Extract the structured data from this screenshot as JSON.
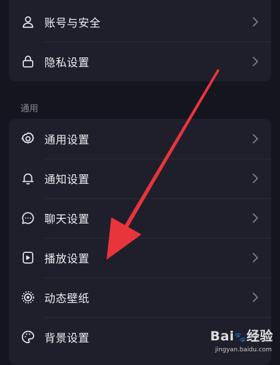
{
  "account_section": {
    "items": [
      {
        "label": "账号与安全",
        "icon": "user-icon"
      },
      {
        "label": "隐私设置",
        "icon": "lock-icon"
      }
    ]
  },
  "general_section": {
    "title": "通用",
    "items": [
      {
        "label": "通用设置",
        "icon": "gear-icon"
      },
      {
        "label": "通知设置",
        "icon": "bell-icon"
      },
      {
        "label": "聊天设置",
        "icon": "chat-bubble-icon"
      },
      {
        "label": "播放设置",
        "icon": "play-device-icon"
      },
      {
        "label": "动态壁纸",
        "icon": "live-wallpaper-icon"
      },
      {
        "label": "背景设置",
        "icon": "palette-icon"
      }
    ]
  },
  "annotation": {
    "arrow_color": "#e8353b"
  },
  "watermark": {
    "logo_prefix": "Bai",
    "logo_suffix": "经验",
    "url": "jingyan.baidu.com"
  },
  "colors": {
    "background": "#15151f",
    "card": "#1f1f2b",
    "text": "#ececf1",
    "muted": "#8c8c98"
  }
}
